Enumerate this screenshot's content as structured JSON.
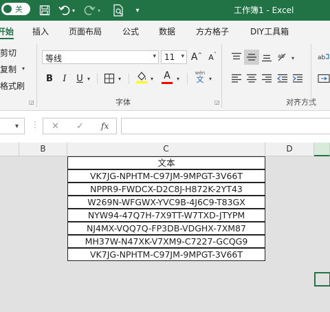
{
  "titlebar": {
    "autosave_label": "关",
    "title": "工作簿1  -  Excel"
  },
  "tabs": [
    {
      "label": "开始",
      "active": true
    },
    {
      "label": "插入"
    },
    {
      "label": "页面布局"
    },
    {
      "label": "公式"
    },
    {
      "label": "数据"
    },
    {
      "label": "方方格子"
    },
    {
      "label": "DIY工具箱"
    }
  ],
  "clipboard": {
    "cut": "剪切",
    "copy": "复制",
    "format_painter": "格式刷"
  },
  "font": {
    "name": "等线",
    "size": "11",
    "group_label": "字体",
    "bold": "B",
    "italic": "I",
    "underline": "U",
    "grow": "A",
    "shrink": "A",
    "font_color_letter": "A",
    "phonetic": "wén",
    "phonetic_sub": "文"
  },
  "alignment": {
    "group_label": "对齐方式"
  },
  "formula_bar": {
    "cancel": "✕",
    "enter": "✓",
    "fx": "fx",
    "value": ""
  },
  "columns": [
    "B",
    "C",
    "D"
  ],
  "selected_column": "",
  "cells": [
    "文本",
    "VK7JG-NPHTM-C97JM-9MPGT-3V66T",
    "NPPR9-FWDCX-D2C8J-H872K-2YT43",
    "W269N-WFGWX-YVC9B-4J6C9-T83GX",
    "NYW94-47Q7H-7X9TT-W7TXD-JTYPM",
    "NJ4MX-VQQ7Q-FP3DB-VDGHX-7XM87",
    "MH37W-N47XK-V7XM9-C7227-GCQG9",
    "VK7JG-NPHTM-C97JM-9MPGT-3V66T"
  ],
  "colors": {
    "accent": "#217346",
    "fill_color": "#ffff00",
    "font_color": "#ff0000"
  }
}
